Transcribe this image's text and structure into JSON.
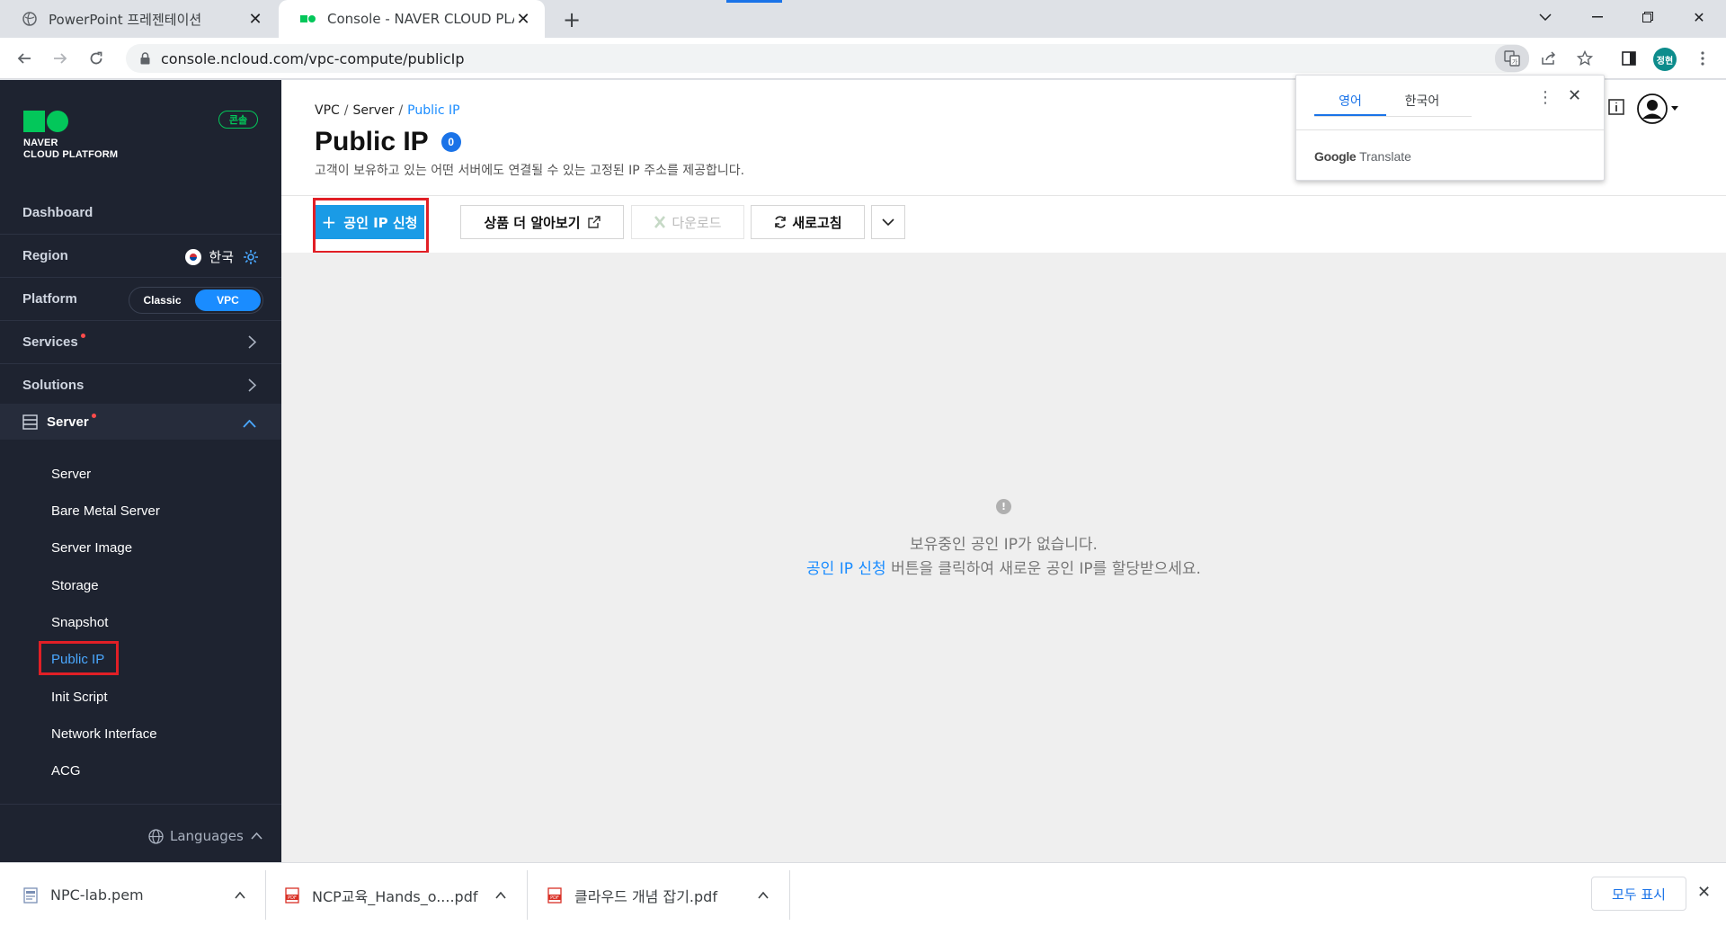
{
  "browser": {
    "tabs": [
      {
        "title": "PowerPoint 프레젠테이션",
        "active": false
      },
      {
        "title": "Console - NAVER CLOUD PLATF",
        "active": true
      }
    ],
    "new_tab": "+",
    "url": "console.ncloud.com/vpc-compute/publicIp",
    "profile_initials": "정현"
  },
  "translate_popup": {
    "tabs": [
      "영어",
      "한국어"
    ],
    "active_tab": "영어",
    "brand_google": "Google",
    "brand_translate": "Translate"
  },
  "sidebar": {
    "logo_line1": "NAVER",
    "logo_line2": "CLOUD PLATFORM",
    "console_badge": "콘솔",
    "dashboard": "Dashboard",
    "region_label": "Region",
    "region_value": "한국",
    "platform_label": "Platform",
    "platform_options": [
      "Classic",
      "VPC"
    ],
    "platform_selected": "VPC",
    "services": "Services",
    "solutions": "Solutions",
    "server_group": "Server",
    "server_items": [
      "Server",
      "Bare Metal Server",
      "Server Image",
      "Storage",
      "Snapshot",
      "Public IP",
      "Init Script",
      "Network Interface",
      "ACG"
    ],
    "active_item": "Public IP",
    "languages": "Languages"
  },
  "main": {
    "breadcrumb": [
      "VPC",
      "Server",
      "Public IP"
    ],
    "title": "Public IP",
    "count": "0",
    "description": "고객이 보유하고 있는 어떤 서버에도 연결될 수 있는 고정된 IP 주소를 제공합니다.",
    "buttons": {
      "request": "공인 IP 신청",
      "learn_more": "상품 더 알아보기",
      "download": "다운로드",
      "refresh": "새로고침"
    },
    "empty_line1": "보유중인 공인 IP가 없습니다.",
    "empty_link": "공인 IP 신청",
    "empty_line2_rest": " 버튼을 클릭하여 새로운 공인 IP를 할당받으세요."
  },
  "downloads": {
    "items": [
      "NPC-lab.pem",
      "NCP교육_Hands_o....pdf",
      "클라우드 개념 잡기.pdf"
    ],
    "show_all": "모두 표시"
  },
  "colors": {
    "sidebar_bg": "#1e2330",
    "brand_green": "#03c75a",
    "primary_blue": "#1a9be6",
    "link_blue": "#1a8cff",
    "highlight_red": "#e11f26"
  }
}
